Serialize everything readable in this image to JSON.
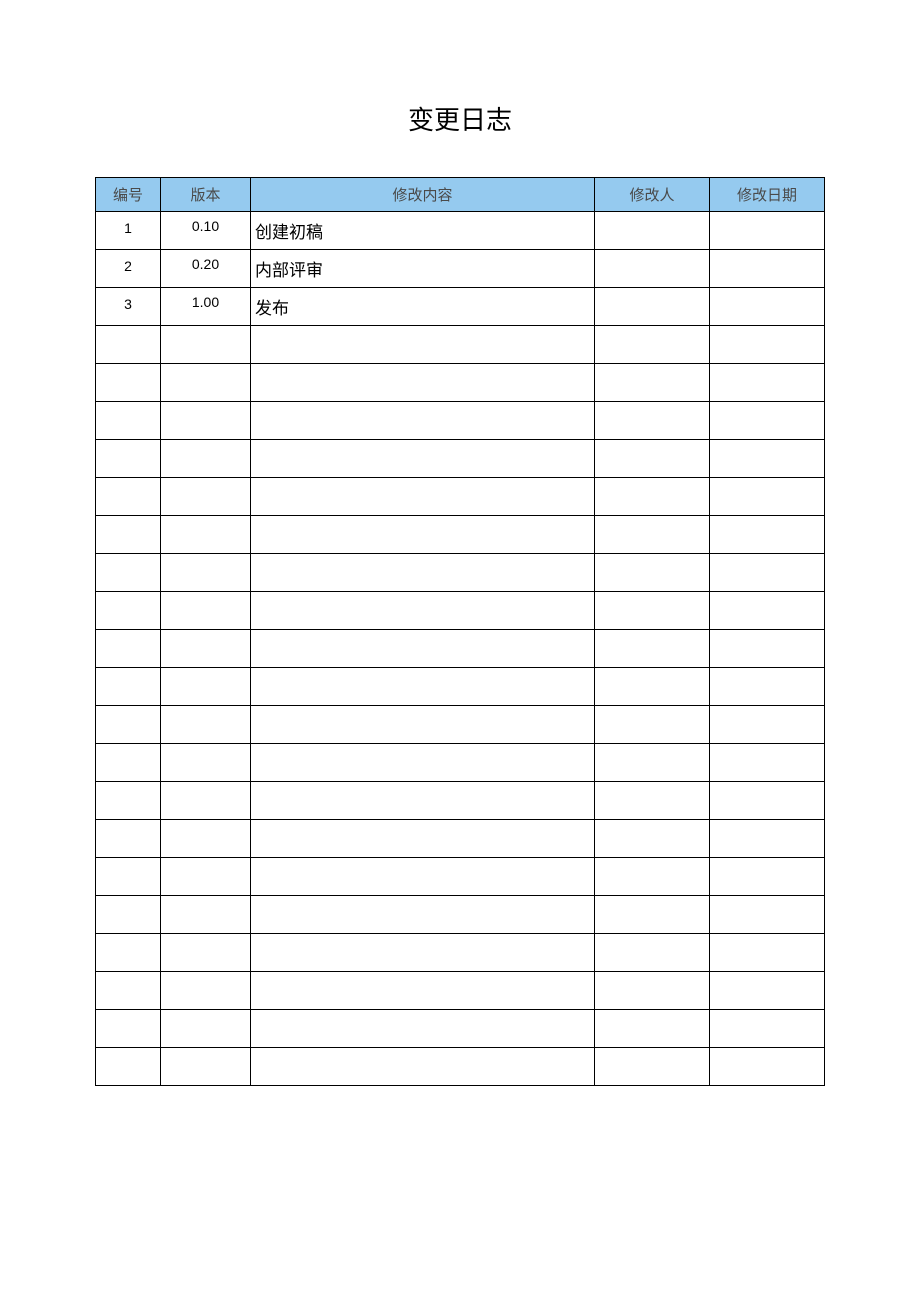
{
  "title": "变更日志",
  "columns": {
    "id": "编号",
    "version": "版本",
    "desc": "修改内容",
    "who": "修改人",
    "date": "修改日期"
  },
  "rows": [
    {
      "id": "1",
      "version": "0.10",
      "desc": "创建初稿",
      "who": "",
      "date": ""
    },
    {
      "id": "2",
      "version": "0.20",
      "desc": "内部评审",
      "who": "",
      "date": ""
    },
    {
      "id": "3",
      "version": "1.00",
      "desc": "发布",
      "who": "",
      "date": ""
    },
    {
      "id": "",
      "version": "",
      "desc": "",
      "who": "",
      "date": ""
    },
    {
      "id": "",
      "version": "",
      "desc": "",
      "who": "",
      "date": ""
    },
    {
      "id": "",
      "version": "",
      "desc": "",
      "who": "",
      "date": ""
    },
    {
      "id": "",
      "version": "",
      "desc": "",
      "who": "",
      "date": ""
    },
    {
      "id": "",
      "version": "",
      "desc": "",
      "who": "",
      "date": ""
    },
    {
      "id": "",
      "version": "",
      "desc": "",
      "who": "",
      "date": ""
    },
    {
      "id": "",
      "version": "",
      "desc": "",
      "who": "",
      "date": ""
    },
    {
      "id": "",
      "version": "",
      "desc": "",
      "who": "",
      "date": ""
    },
    {
      "id": "",
      "version": "",
      "desc": "",
      "who": "",
      "date": ""
    },
    {
      "id": "",
      "version": "",
      "desc": "",
      "who": "",
      "date": ""
    },
    {
      "id": "",
      "version": "",
      "desc": "",
      "who": "",
      "date": ""
    },
    {
      "id": "",
      "version": "",
      "desc": "",
      "who": "",
      "date": ""
    },
    {
      "id": "",
      "version": "",
      "desc": "",
      "who": "",
      "date": ""
    },
    {
      "id": "",
      "version": "",
      "desc": "",
      "who": "",
      "date": ""
    },
    {
      "id": "",
      "version": "",
      "desc": "",
      "who": "",
      "date": ""
    },
    {
      "id": "",
      "version": "",
      "desc": "",
      "who": "",
      "date": ""
    },
    {
      "id": "",
      "version": "",
      "desc": "",
      "who": "",
      "date": ""
    },
    {
      "id": "",
      "version": "",
      "desc": "",
      "who": "",
      "date": ""
    },
    {
      "id": "",
      "version": "",
      "desc": "",
      "who": "",
      "date": ""
    },
    {
      "id": "",
      "version": "",
      "desc": "",
      "who": "",
      "date": ""
    }
  ]
}
